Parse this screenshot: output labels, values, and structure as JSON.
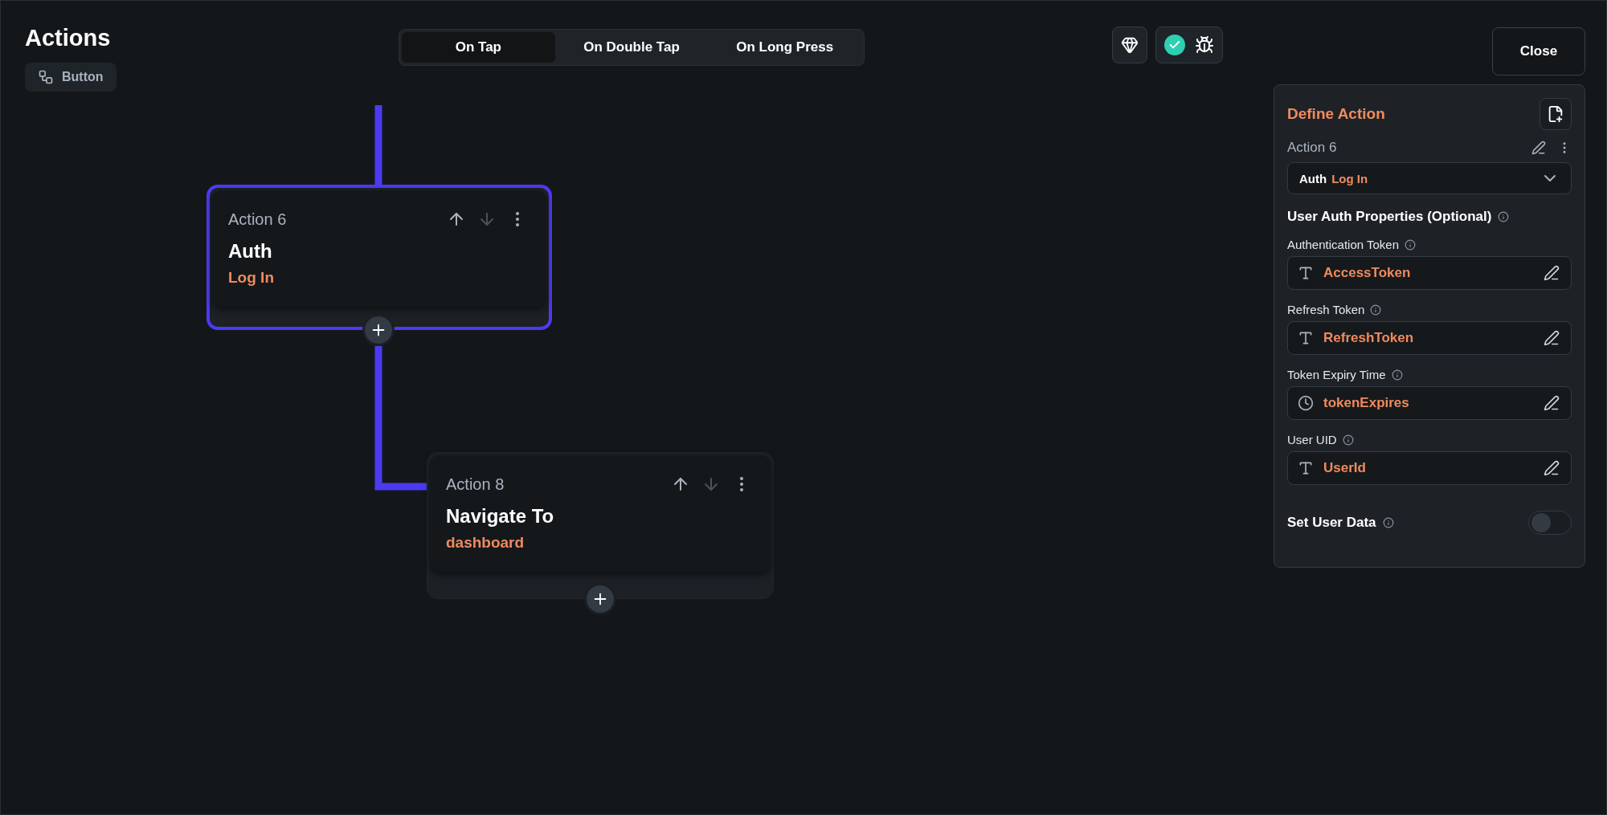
{
  "header": {
    "title": "Actions",
    "widget_chip": "Button"
  },
  "tabs": [
    {
      "label": "On Tap",
      "selected": true
    },
    {
      "label": "On Double Tap",
      "selected": false
    },
    {
      "label": "On Long Press",
      "selected": false
    }
  ],
  "close_button": "Close",
  "nodes": [
    {
      "label": "Action 6",
      "title": "Auth",
      "subtitle": "Log In",
      "selected": true
    },
    {
      "label": "Action 8",
      "title": "Navigate To",
      "subtitle": "dashboard",
      "selected": false
    }
  ],
  "panel": {
    "title": "Define Action",
    "action_label": "Action 6",
    "action_type": "Auth",
    "action_subtype": "Log In",
    "section_title": "User Auth Properties (Optional)",
    "fields": [
      {
        "label": "Authentication Token",
        "kind": "text",
        "value": "AccessToken"
      },
      {
        "label": "Refresh Token",
        "kind": "text",
        "value": "RefreshToken"
      },
      {
        "label": "Token Expiry Time",
        "kind": "time",
        "value": "tokenExpires"
      },
      {
        "label": "User UID",
        "kind": "text",
        "value": "UserId"
      }
    ],
    "toggle": {
      "label": "Set User Data",
      "on": false
    }
  }
}
